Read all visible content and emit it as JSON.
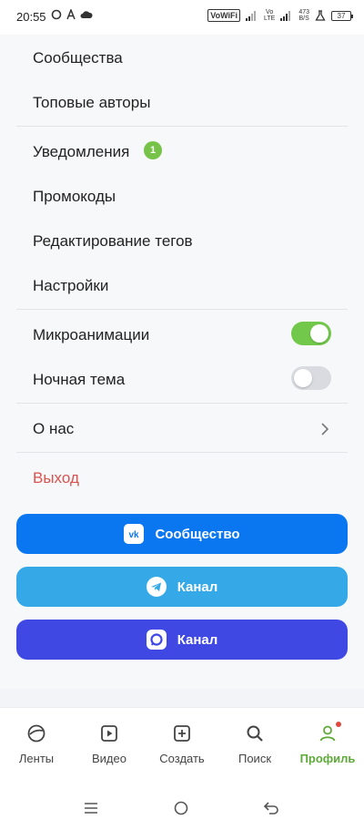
{
  "status_bar": {
    "time": "20:55",
    "vowifi": "VoWiFi",
    "volte_top": "Vo",
    "volte_bottom": "LTE",
    "speed_top": "473",
    "speed_bottom": "B/S",
    "battery": "37"
  },
  "menu": {
    "communities": "Сообщества",
    "top_authors": "Топовые авторы",
    "notifications": "Уведомления",
    "notifications_badge": "1",
    "promocodes": "Промокоды",
    "tag_editing": "Редактирование тегов",
    "settings": "Настройки",
    "microanimations": "Микроанимации",
    "microanimations_on": true,
    "night_theme": "Ночная тема",
    "night_theme_on": false,
    "about": "О нас",
    "logout": "Выход"
  },
  "social": [
    {
      "label": "Сообщество",
      "color": "#0a77f1",
      "icon": "vk-icon"
    },
    {
      "label": "Канал",
      "color": "#35a9e8",
      "icon": "telegram-icon"
    },
    {
      "label": "Канал",
      "color": "#3f48e3",
      "icon": "max-messenger-icon"
    }
  ],
  "tabs": [
    {
      "label": "Ленты",
      "icon": "feed-icon"
    },
    {
      "label": "Видео",
      "icon": "video-icon"
    },
    {
      "label": "Создать",
      "icon": "create-icon"
    },
    {
      "label": "Поиск",
      "icon": "search-icon"
    },
    {
      "label": "Профиль",
      "icon": "profile-icon",
      "active": true
    }
  ],
  "colors": {
    "accent_green": "#72c84a",
    "logout_red": "#d9534f"
  }
}
